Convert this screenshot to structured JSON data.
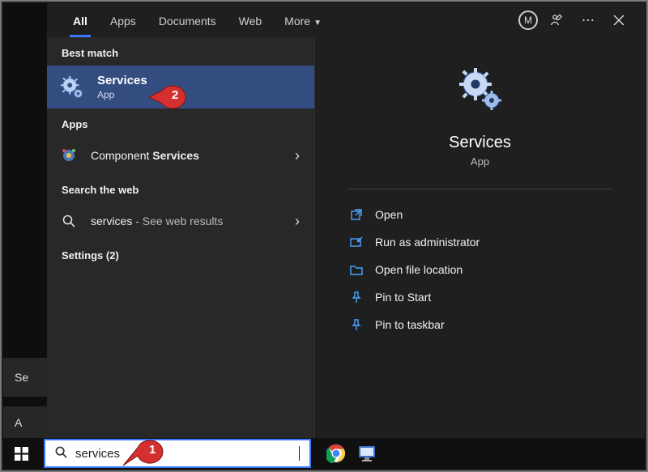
{
  "nav": {
    "tabs": [
      "All",
      "Apps",
      "Documents",
      "Web",
      "More"
    ],
    "avatar_initial": "M"
  },
  "left": {
    "best_match_hdr": "Best match",
    "services": {
      "title": "Services",
      "sub": "App"
    },
    "apps_hdr": "Apps",
    "component": {
      "prefix": "Component ",
      "bold": "Services"
    },
    "web_hdr": "Search the web",
    "web": {
      "term": "services",
      "suffix": " - See web results"
    },
    "settings_hdr": "Settings (2)"
  },
  "preview": {
    "title": "Services",
    "sub": "App",
    "actions": [
      "Open",
      "Run as administrator",
      "Open file location",
      "Pin to Start",
      "Pin to taskbar"
    ]
  },
  "search": {
    "value": "services"
  },
  "annotations": {
    "one": "1",
    "two": "2"
  },
  "bg": {
    "tab1": "Se",
    "tab2": "A"
  }
}
